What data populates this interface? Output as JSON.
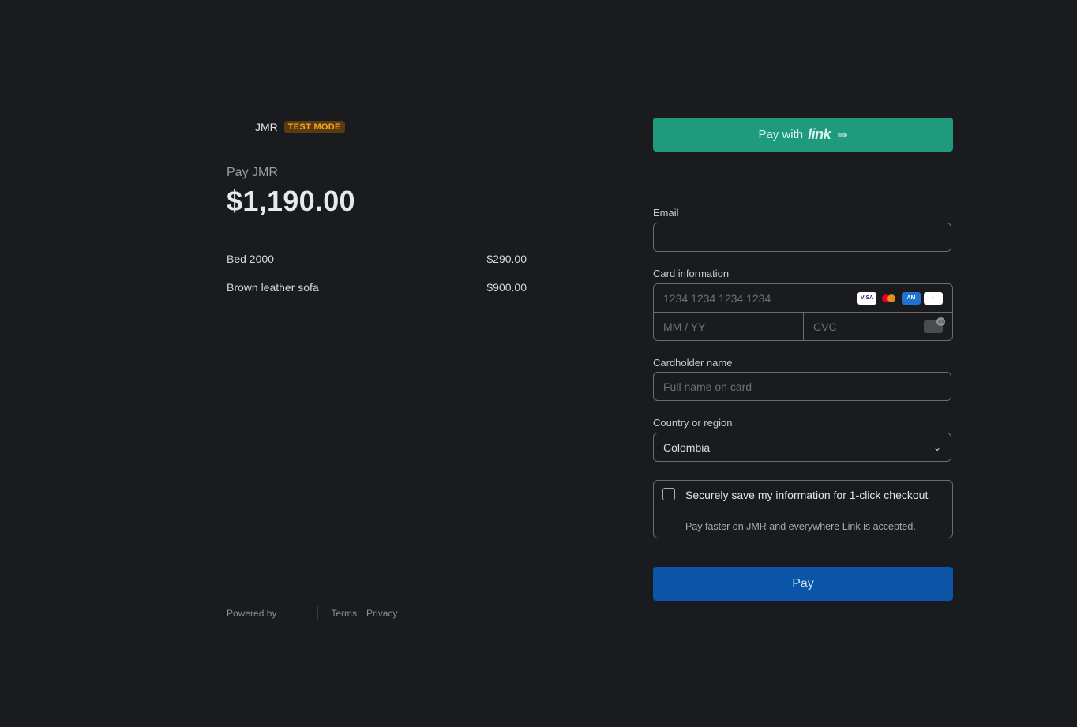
{
  "merchant": {
    "name": "JMR",
    "badge": "TEST MODE"
  },
  "summary": {
    "pay_to": "Pay JMR",
    "amount": "$1,190.00",
    "items": [
      {
        "name": "Bed 2000",
        "price": "$290.00"
      },
      {
        "name": "Brown leather sofa",
        "price": "$900.00"
      }
    ]
  },
  "footer": {
    "powered_by": "Powered by",
    "terms": "Terms",
    "privacy": "Privacy"
  },
  "link_button": {
    "label": "Pay with",
    "logo": "link",
    "arrow": "⇛"
  },
  "form": {
    "email_label": "Email",
    "email_value": "",
    "card_label": "Card information",
    "card_number_placeholder": "1234 1234 1234 1234",
    "expiry_placeholder": "MM / YY",
    "cvc_placeholder": "CVC",
    "card_brands": [
      "VISA",
      "mastercard",
      "AMEX",
      "diners"
    ],
    "cardholder_label": "Cardholder name",
    "cardholder_placeholder": "Full name on card",
    "country_label": "Country or region",
    "country_value": "Colombia",
    "save_title": "Securely save my information for 1-click checkout",
    "save_subtitle": "Pay faster on JMR and everywhere Link is accepted.",
    "save_checked": false
  },
  "pay_button": {
    "label": "Pay"
  },
  "colors": {
    "background": "#1a1b1e",
    "link_green": "#1e9a7c",
    "pay_blue": "#0b55a8",
    "badge_bg": "#5a3a10",
    "badge_text": "#f5a623"
  }
}
